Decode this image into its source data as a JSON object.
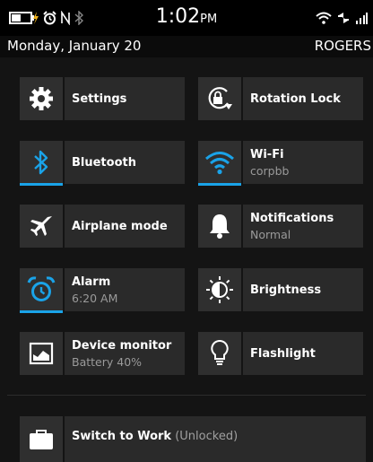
{
  "status": {
    "time": "1:02",
    "ampm": "PM"
  },
  "daterow": {
    "date": "Monday, January 20",
    "carrier": "ROGERS"
  },
  "tiles": [
    {
      "title": "Settings",
      "icon": "gear-icon"
    },
    {
      "title": "Rotation Lock",
      "icon": "rotation-lock-icon"
    },
    {
      "title": "Bluetooth",
      "icon": "bluetooth-icon",
      "active": true
    },
    {
      "title": "Wi-Fi",
      "subtitle": "corpbb",
      "icon": "wifi-icon",
      "active": true
    },
    {
      "title": "Airplane mode",
      "icon": "airplane-icon"
    },
    {
      "title": "Notifications",
      "subtitle": "Normal",
      "icon": "bell-icon"
    },
    {
      "title": "Alarm",
      "subtitle": "6:20 AM",
      "icon": "alarm-clock-icon",
      "active": true
    },
    {
      "title": "Brightness",
      "icon": "brightness-icon"
    },
    {
      "title": "Device monitor",
      "subtitle": "Battery 40%",
      "icon": "device-monitor-icon"
    },
    {
      "title": "Flashlight",
      "icon": "lightbulb-icon"
    }
  ],
  "work": {
    "title": "Switch to Work",
    "status": "(Unlocked)",
    "icon": "briefcase-icon"
  },
  "colors": {
    "accent": "#1aa3e8",
    "tile_bg": "#2a2a2a",
    "page_bg": "#141414"
  }
}
